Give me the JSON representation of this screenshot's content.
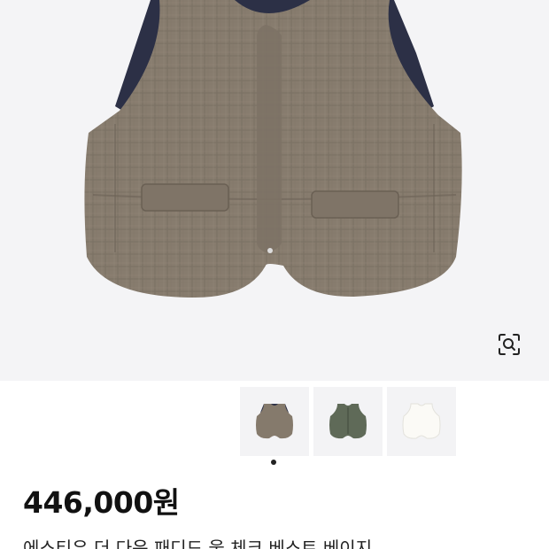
{
  "product": {
    "price": "446,000원",
    "title": "에스티유 더 다운 패디드 울 체크 베스트 베이지"
  },
  "gallery": {
    "thumbnails": [
      {
        "label": "vest-beige-check",
        "color": "#857a6c"
      },
      {
        "label": "vest-olive-check",
        "color": "#5f6a58"
      },
      {
        "label": "vest-ivory",
        "color": "#f7f6f2"
      }
    ],
    "active_index": 0,
    "lens_icon": "image-search-icon"
  },
  "colors": {
    "hero_bg": "#f4f4f6",
    "vest_main": "#857a6c",
    "vest_lining": "#2c3046"
  }
}
